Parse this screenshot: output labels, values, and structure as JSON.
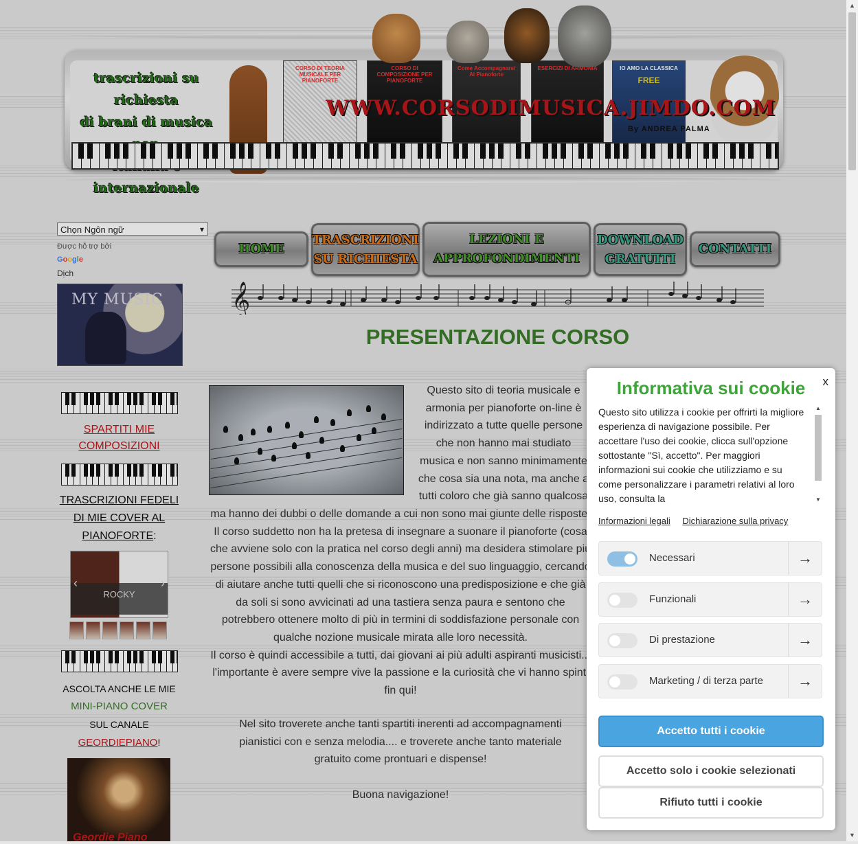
{
  "header": {
    "left_text": [
      "trascrizioni su richiesta",
      "di brani di musica pop",
      "italiana e internazionale"
    ],
    "site_url": "WWW.CORSODIMUSICA.JIMDO.COM",
    "byline": "By ANDREA PALMA",
    "books": [
      "CORSO DI TEORIA MUSICALE PER PIANOFORTE",
      "CORSO DI COMPOSIZIONE PER PIANOFORTE",
      "Come Accompagnarsi Al Pianoforte",
      "ESERCIZI DI ARMONIA",
      "IO AMO LA CLASSICA"
    ],
    "book_free_tag": "FREE"
  },
  "sidebar": {
    "language_select": "Chọn Ngôn ngữ",
    "powered_by": "Được hỗ trợ bởi",
    "google_label": "Google",
    "translate_label": "Dịch",
    "my_music": "MY MUSIC",
    "spartiti_link": "SPARTITI MIE COMPOSIZIONI",
    "trascrizioni_text": "TRASCRIZIONI FEDELI DI MIE COVER AL PIANOFORTE",
    "trascrizioni_colon": ":",
    "slider_caption": "ROCKY",
    "ascolta_line1": "ASCOLTA ANCHE LE MIE",
    "ascolta_line2": "MINI-PIANO COVER",
    "ascolta_line3": "SUL CANALE",
    "ascolta_channel": "GEORDIEPIANO",
    "ascolta_exclaim": "!",
    "video_caption": "Geordie Piano"
  },
  "nav": {
    "home": "HOME",
    "trascrizioni": "TRASCRIZIONI SU RICHIESTA",
    "lezioni": "LEZIONI E APPROFONDIMENTI",
    "download": "DOWNLOAD GRATUITI",
    "contatti": "CONTATTI"
  },
  "main": {
    "title": "PRESENTAZIONE CORSO",
    "p1_lines": [
      "Questo sito di teoria musicale e",
      "armonia per pianoforte on-line è",
      "indirizzato a tutte quelle persone",
      "che non hanno mai studiato",
      "musica e non sanno minimamente",
      "che cosa sia una nota, ma anche a",
      "tutti coloro che già sanno qualcosa"
    ],
    "p1_full_lines": [
      "ma hanno dei dubbi o delle domande a cui non sono mai giunte delle risposte.",
      "Il corso suddetto non ha la pretesa di insegnare a suonare il pianoforte (cosa",
      "che avviene solo con la pratica nel corso degli anni) ma desidera stimolare più",
      "persone possibili alla conoscenza della musica e del suo linguaggio, cercando",
      "di aiutare anche tutti quelli che si riconoscono una predisposizione e che già",
      "da soli si sono avvicinati ad una tastiera senza paura e sentono che",
      "potrebbero ottenere molto di più in termini di soddisfazione personale con",
      "qualche nozione musicale mirata alle loro necessità.",
      "Il corso è quindi accessibile a tutti, dai giovani ai più adulti aspiranti musicisti...",
      "l'importante è avere sempre vive la passione e la curiosità che vi hanno spinti",
      "fin qui!"
    ],
    "p2_lines": [
      "Nel sito troverete anche tanti spartiti inerenti ad accompagnamenti",
      "pianistici con e senza melodia.... e troverete anche tanto materiale",
      "gratuito come prontuari e dispense!"
    ],
    "closing": "Buona navigazione!"
  },
  "cookie": {
    "close": "x",
    "title": "Informativa sui cookie",
    "description": "Questo sito utilizza i cookie per offrirti la migliore esperienza di navigazione possibile. Per accettare l'uso dei cookie, clicca sull'opzione sottostante \"Sì, accetto\". Per maggiori informazioni sui cookie che utilizziamo e su come personalizzare i parametri relativi al loro uso, consulta la",
    "link_legal": "Informazioni legali",
    "link_privacy": "Dichiarazione sulla privacy",
    "categories": [
      {
        "label": "Necessari",
        "enabled": true
      },
      {
        "label": "Funzionali",
        "enabled": false
      },
      {
        "label": "Di prestazione",
        "enabled": false
      },
      {
        "label": "Marketing / di terza parte",
        "enabled": false
      }
    ],
    "arrow_glyph": "→",
    "accept_all": "Accetto tutti i cookie",
    "accept_selected": "Accetto solo i cookie selezionati",
    "reject_all": "Rifiuto tutti i cookie"
  },
  "colors": {
    "title_green": "#3b7b2a",
    "link_red": "#c0181c",
    "cookie_green": "#3ea53a",
    "accept_blue": "#4aa4e0"
  }
}
